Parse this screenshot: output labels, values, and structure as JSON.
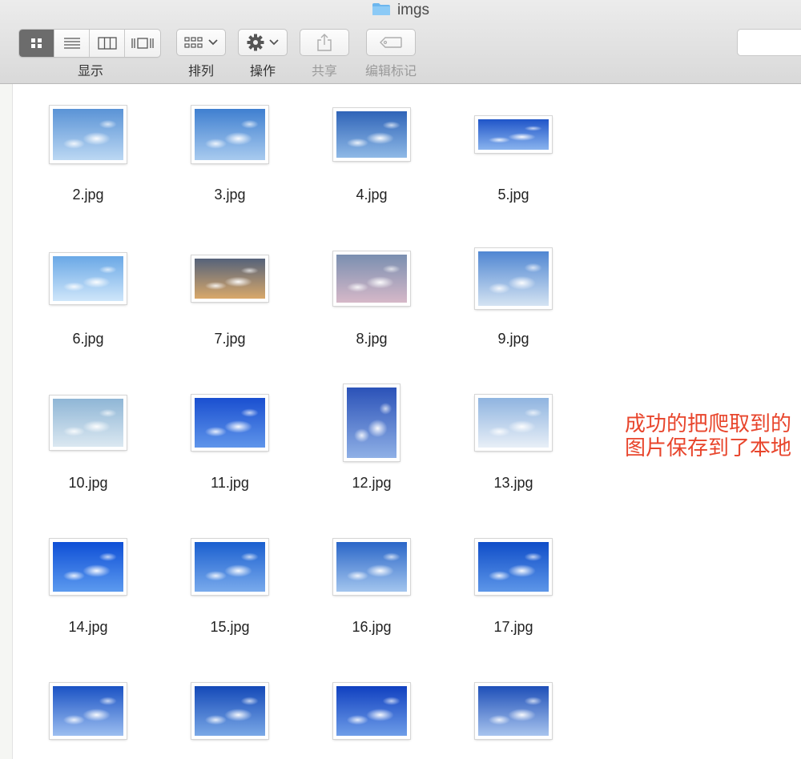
{
  "window": {
    "title": "imgs"
  },
  "toolbar": {
    "view_label": "显示",
    "arrange_label": "排列",
    "action_label": "操作",
    "share_label": "共享",
    "tags_label": "编辑标记"
  },
  "files": [
    {
      "name": "2.jpg",
      "sky": [
        "#5a93d6",
        "#bcd8f3"
      ]
    },
    {
      "name": "3.jpg",
      "sky": [
        "#3f7fd0",
        "#a9cbef"
      ]
    },
    {
      "name": "4.jpg",
      "sky": [
        "#2f64b8",
        "#8fb9e6"
      ]
    },
    {
      "name": "5.jpg",
      "sky": [
        "#1f55c8",
        "#8ab4ee"
      ]
    },
    {
      "name": "6.jpg",
      "sky": [
        "#6aa8e6",
        "#cfe6fa"
      ]
    },
    {
      "name": "7.jpg",
      "sky": [
        "#55627a",
        "#d9a86a"
      ]
    },
    {
      "name": "8.jpg",
      "sky": [
        "#7a8fb0",
        "#d6b8c8"
      ]
    },
    {
      "name": "9.jpg",
      "sky": [
        "#4f86d2",
        "#d4e3f2"
      ]
    },
    {
      "name": "10.jpg",
      "sky": [
        "#8fb6d6",
        "#dbe8f1"
      ]
    },
    {
      "name": "11.jpg",
      "sky": [
        "#1a4fd0",
        "#5f95ea"
      ]
    },
    {
      "name": "12.jpg",
      "sky": [
        "#2b52b8",
        "#8fb0e6"
      ]
    },
    {
      "name": "13.jpg",
      "sky": [
        "#8fb4e0",
        "#e8eff7"
      ]
    },
    {
      "name": "14.jpg",
      "sky": [
        "#0e4fd6",
        "#5c9aef"
      ]
    },
    {
      "name": "15.jpg",
      "sky": [
        "#1a5fcf",
        "#79aaec"
      ]
    },
    {
      "name": "16.jpg",
      "sky": [
        "#2a66c8",
        "#a3c5ee"
      ]
    },
    {
      "name": "17.jpg",
      "sky": [
        "#0f4dc8",
        "#5d96e8"
      ]
    },
    {
      "name": "",
      "sky": [
        "#1a52c4",
        "#9cbef0"
      ]
    },
    {
      "name": "",
      "sky": [
        "#1449b8",
        "#7aa8e6"
      ]
    },
    {
      "name": "",
      "sky": [
        "#1040c0",
        "#6e9de8"
      ]
    },
    {
      "name": "",
      "sky": [
        "#1e4fb8",
        "#a8c4ee"
      ]
    }
  ],
  "annotation": {
    "text": "成功的把爬取到的图片保存到了本地"
  }
}
